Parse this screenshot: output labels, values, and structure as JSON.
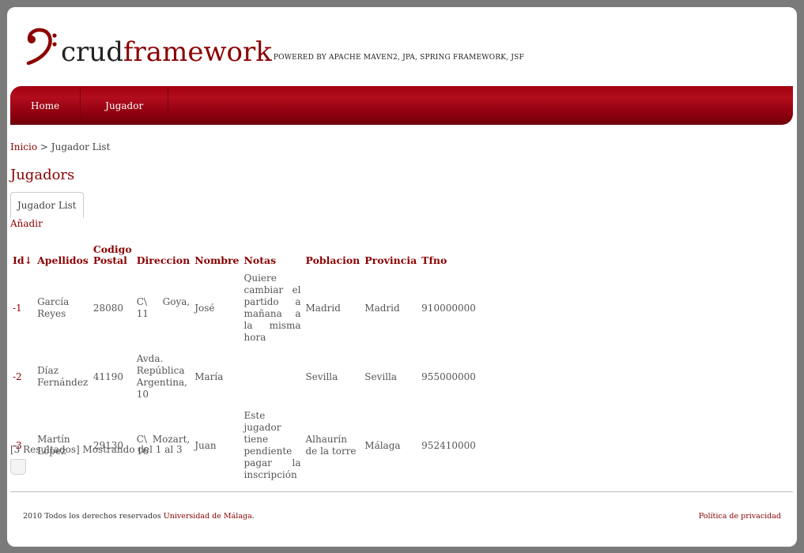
{
  "brand": {
    "part1": "crud",
    "part2": "framework",
    "powered": "POWERED BY APACHE MAVEN2, JPA, SPRING FRAMEWORK, JSF"
  },
  "nav": {
    "items": [
      "Home",
      "Jugador"
    ]
  },
  "breadcrumb": {
    "home": "Inicio",
    "sep": " > ",
    "current": "Jugador List"
  },
  "page_title": "Jugadors",
  "tab_label": "Jugador List",
  "add_label": "Añadir",
  "table": {
    "headers": [
      "Id↓",
      "Apellidos",
      "Codigo Postal",
      "Direccion",
      "Nombre",
      "Notas",
      "Poblacion",
      "Provincia",
      "Tfno"
    ],
    "rows": [
      [
        "-1",
        "García Reyes",
        "28080",
        "C\\ Goya, 11",
        "José",
        "Quiere cambiar el partido a mañana a la misma hora",
        "Madrid",
        "Madrid",
        "910000000"
      ],
      [
        "-2",
        "Díaz Fernández",
        "41190",
        "Avda. República Argentina, 10",
        "María",
        "",
        "Sevilla",
        "Sevilla",
        "955000000"
      ],
      [
        "-3",
        "Martín López",
        "29130",
        "C\\ Mozart, 16",
        "Juan",
        "Este jugador tiene pendiente pagar la inscripción",
        "Alhaurín de la torre",
        "Málaga",
        "952410000"
      ]
    ]
  },
  "summary": "[3 Resultados] Mostrando del 1 al 3",
  "footer": {
    "text": "2010 Todos los derechos reservados ",
    "link": "Universidad de Málaga",
    "end": ".",
    "privacy": "Política de privacidad"
  },
  "colors": {
    "accent": "#8b0000",
    "nav": "#a1000f"
  }
}
